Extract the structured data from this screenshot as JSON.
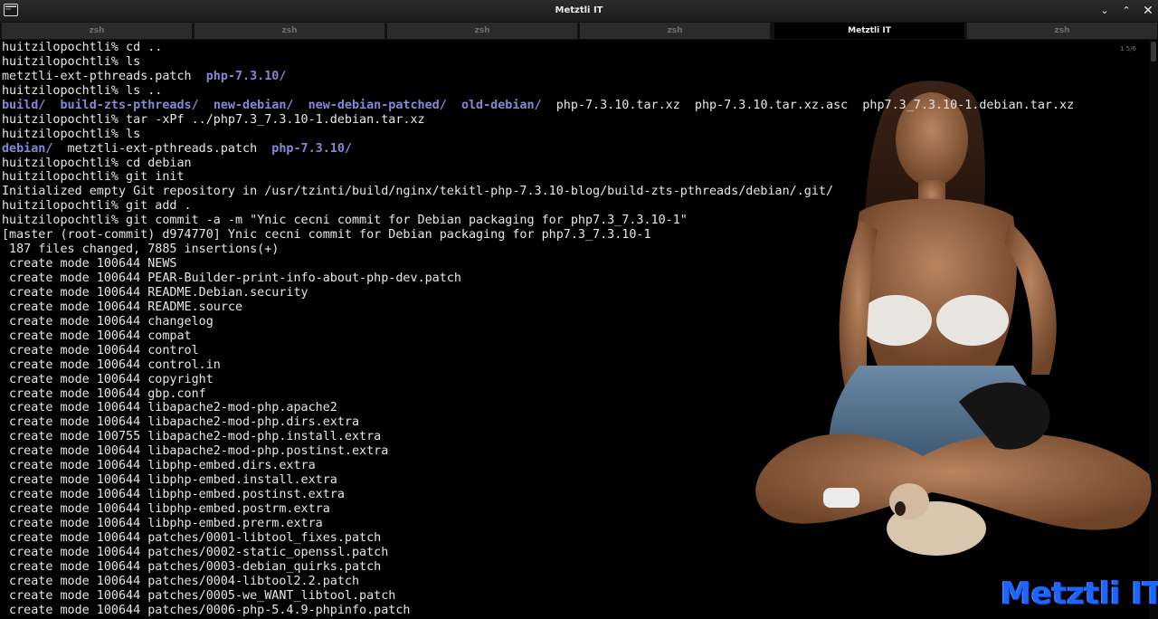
{
  "window": {
    "title": "Metztli IT",
    "menu_icon": "chevron-down-icon",
    "minimize_icon": "chevron-up-icon",
    "close_icon": "close-icon"
  },
  "tabs": [
    {
      "label": "zsh",
      "active": false
    },
    {
      "label": "zsh",
      "active": false
    },
    {
      "label": "zsh",
      "active": false
    },
    {
      "label": "zsh",
      "active": false
    },
    {
      "label": "Metztli IT",
      "active": true
    },
    {
      "label": "zsh",
      "active": false
    }
  ],
  "scroll_indicator": "1 5/6",
  "terminal": {
    "lines": [
      {
        "segments": [
          {
            "text": "huitzilopochtli% cd .."
          }
        ]
      },
      {
        "segments": [
          {
            "text": "huitzilopochtli% ls"
          }
        ]
      },
      {
        "segments": [
          {
            "text": "metztli-ext-pthreads.patch  "
          },
          {
            "text": "php-7.3.10/",
            "dir": true
          }
        ]
      },
      {
        "segments": [
          {
            "text": "huitzilopochtli% ls .."
          }
        ]
      },
      {
        "segments": [
          {
            "text": "build/",
            "dir": true
          },
          {
            "text": "  "
          },
          {
            "text": "build-zts-pthreads/",
            "dir": true
          },
          {
            "text": "  "
          },
          {
            "text": "new-debian/",
            "dir": true
          },
          {
            "text": "  "
          },
          {
            "text": "new-debian-patched/",
            "dir": true
          },
          {
            "text": "  "
          },
          {
            "text": "old-debian/",
            "dir": true
          },
          {
            "text": "  php-7.3.10.tar.xz  php-7.3.10.tar.xz.asc  php7.3_7.3.10-1.debian.tar.xz"
          }
        ]
      },
      {
        "segments": [
          {
            "text": "huitzilopochtli% tar -xPf ../php7.3_7.3.10-1.debian.tar.xz"
          }
        ]
      },
      {
        "segments": [
          {
            "text": "huitzilopochtli% ls"
          }
        ]
      },
      {
        "segments": [
          {
            "text": "debian/",
            "dir": true
          },
          {
            "text": "  metztli-ext-pthreads.patch  "
          },
          {
            "text": "php-7.3.10/",
            "dir": true
          }
        ]
      },
      {
        "segments": [
          {
            "text": "huitzilopochtli% cd debian"
          }
        ]
      },
      {
        "segments": [
          {
            "text": "huitzilopochtli% git init"
          }
        ]
      },
      {
        "segments": [
          {
            "text": "Initialized empty Git repository in /usr/tzinti/build/nginx/tekitl-php-7.3.10-blog/build-zts-pthreads/debian/.git/"
          }
        ]
      },
      {
        "segments": [
          {
            "text": "huitzilopochtli% git add ."
          }
        ]
      },
      {
        "segments": [
          {
            "text": "huitzilopochtli% git commit -a -m \"Ynic cecni commit for Debian packaging for php7.3_7.3.10-1\""
          }
        ]
      },
      {
        "segments": [
          {
            "text": "[master (root-commit) d974770] Ynic cecni commit for Debian packaging for php7.3_7.3.10-1"
          }
        ]
      },
      {
        "segments": [
          {
            "text": " 187 files changed, 7885 insertions(+)"
          }
        ]
      },
      {
        "segments": [
          {
            "text": " create mode 100644 NEWS"
          }
        ]
      },
      {
        "segments": [
          {
            "text": " create mode 100644 PEAR-Builder-print-info-about-php-dev.patch"
          }
        ]
      },
      {
        "segments": [
          {
            "text": " create mode 100644 README.Debian.security"
          }
        ]
      },
      {
        "segments": [
          {
            "text": " create mode 100644 README.source"
          }
        ]
      },
      {
        "segments": [
          {
            "text": " create mode 100644 changelog"
          }
        ]
      },
      {
        "segments": [
          {
            "text": " create mode 100644 compat"
          }
        ]
      },
      {
        "segments": [
          {
            "text": " create mode 100644 control"
          }
        ]
      },
      {
        "segments": [
          {
            "text": " create mode 100644 control.in"
          }
        ]
      },
      {
        "segments": [
          {
            "text": " create mode 100644 copyright"
          }
        ]
      },
      {
        "segments": [
          {
            "text": " create mode 100644 gbp.conf"
          }
        ]
      },
      {
        "segments": [
          {
            "text": " create mode 100644 libapache2-mod-php.apache2"
          }
        ]
      },
      {
        "segments": [
          {
            "text": " create mode 100644 libapache2-mod-php.dirs.extra"
          }
        ]
      },
      {
        "segments": [
          {
            "text": " create mode 100755 libapache2-mod-php.install.extra"
          }
        ]
      },
      {
        "segments": [
          {
            "text": " create mode 100644 libapache2-mod-php.postinst.extra"
          }
        ]
      },
      {
        "segments": [
          {
            "text": " create mode 100644 libphp-embed.dirs.extra"
          }
        ]
      },
      {
        "segments": [
          {
            "text": " create mode 100644 libphp-embed.install.extra"
          }
        ]
      },
      {
        "segments": [
          {
            "text": " create mode 100644 libphp-embed.postinst.extra"
          }
        ]
      },
      {
        "segments": [
          {
            "text": " create mode 100644 libphp-embed.postrm.extra"
          }
        ]
      },
      {
        "segments": [
          {
            "text": " create mode 100644 libphp-embed.prerm.extra"
          }
        ]
      },
      {
        "segments": [
          {
            "text": " create mode 100644 patches/0001-libtool_fixes.patch"
          }
        ]
      },
      {
        "segments": [
          {
            "text": " create mode 100644 patches/0002-static_openssl.patch"
          }
        ]
      },
      {
        "segments": [
          {
            "text": " create mode 100644 patches/0003-debian_quirks.patch"
          }
        ]
      },
      {
        "segments": [
          {
            "text": " create mode 100644 patches/0004-libtool2.2.patch"
          }
        ]
      },
      {
        "segments": [
          {
            "text": " create mode 100644 patches/0005-we_WANT_libtool.patch"
          }
        ]
      },
      {
        "segments": [
          {
            "text": " create mode 100644 patches/0006-php-5.4.9-phpinfo.patch"
          }
        ]
      }
    ]
  },
  "watermark": "Metztli IT",
  "colors": {
    "directory": "#8a86d6",
    "text": "#e6e6e6",
    "watermark": "#1e64ff",
    "background": "#000000"
  }
}
